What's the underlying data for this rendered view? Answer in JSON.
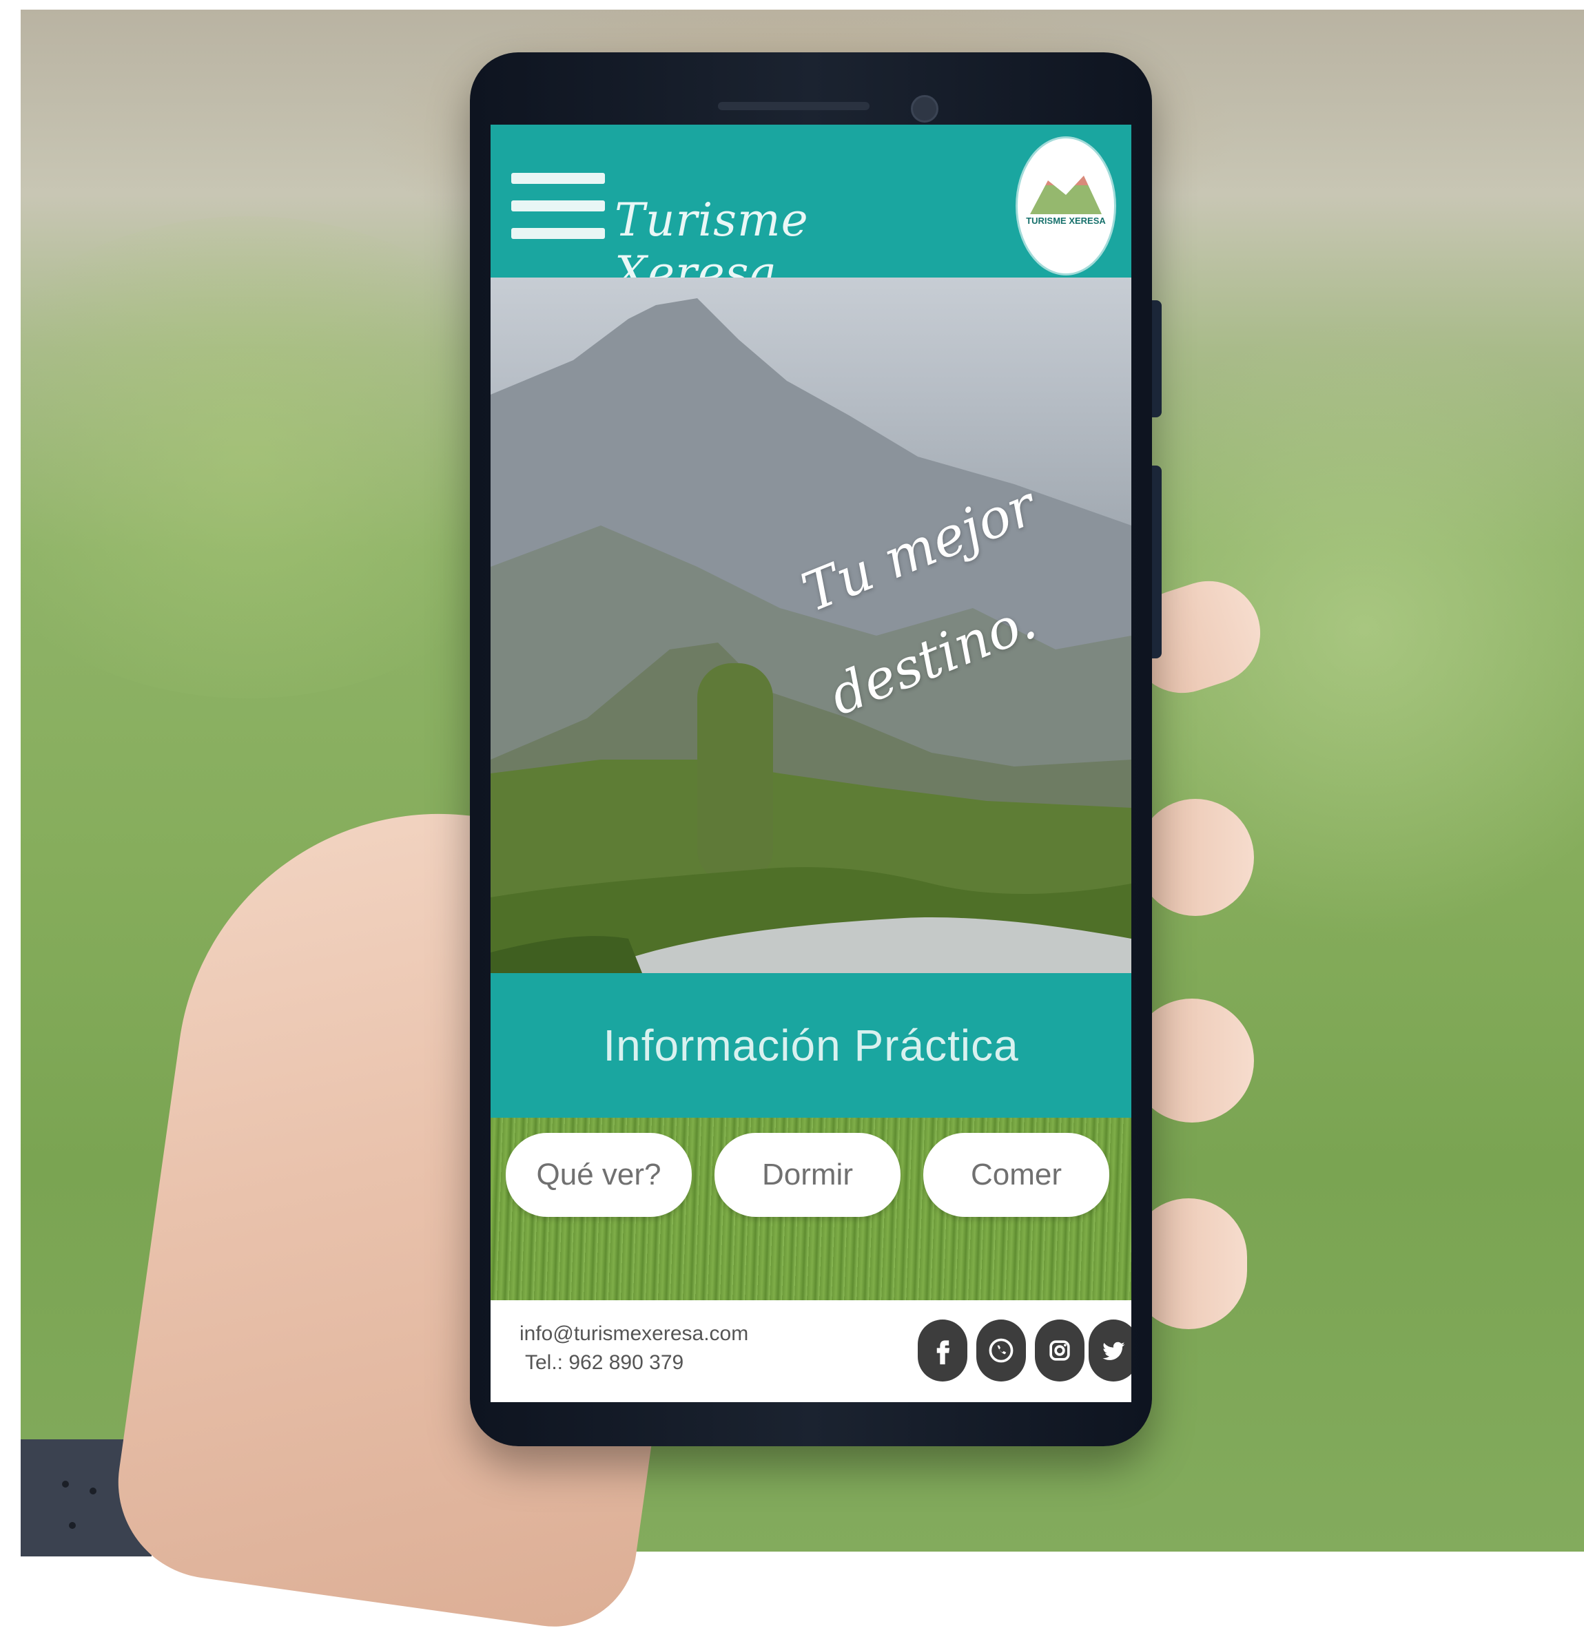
{
  "app": {
    "title": "Turisme Xeresa",
    "logo_text": "TURISME XERESA"
  },
  "hero": {
    "tagline_line1": "Tu mejor",
    "tagline_line2": "destino."
  },
  "info_band": {
    "label": "Información Práctica"
  },
  "buttons": [
    {
      "label": "Qué ver?"
    },
    {
      "label": "Dormir"
    },
    {
      "label": "Comer"
    }
  ],
  "footer": {
    "email": "info@turismexeresa.com",
    "phone": "Tel.: 962 890 379"
  },
  "social_icons": [
    "facebook-icon",
    "whatsapp-icon",
    "instagram-icon",
    "twitter-icon"
  ],
  "colors": {
    "brand_teal": "#1aa6a0",
    "button_bg": "#ffffff",
    "footer_icon": "#3d3d3d"
  }
}
